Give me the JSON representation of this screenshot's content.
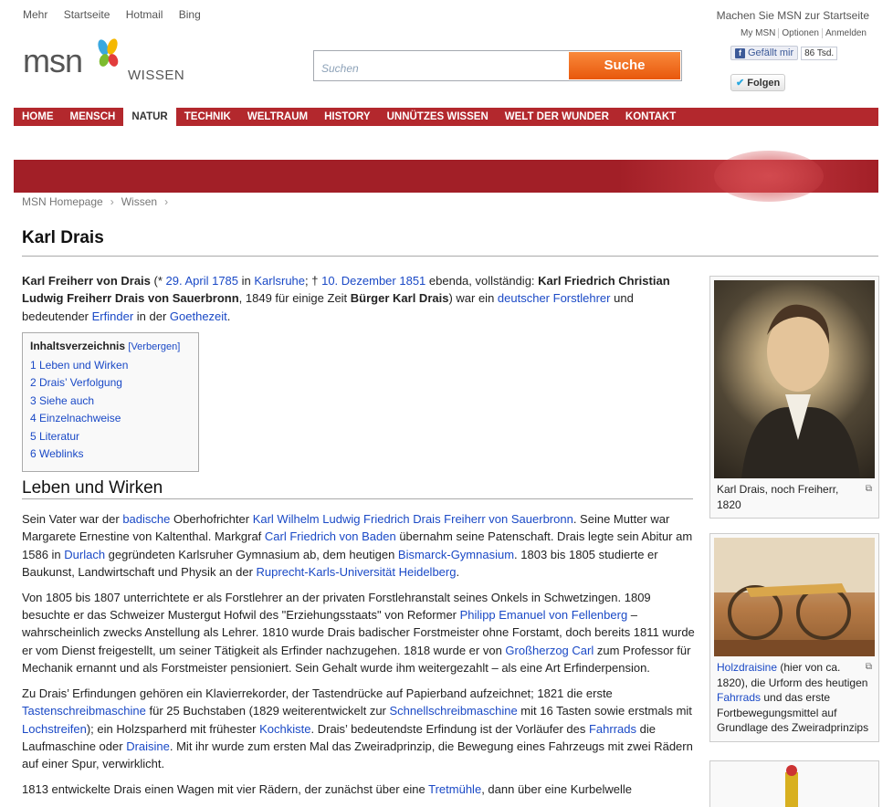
{
  "top_links": [
    "Mehr",
    "Startseite",
    "Hotmail",
    "Bing"
  ],
  "top_right": {
    "startpage": "Machen Sie MSN zur Startseite",
    "links": [
      "My MSN",
      "Optionen",
      "Anmelden"
    ],
    "fb_like": "Gefällt mir",
    "fb_count": "86 Tsd.",
    "twitter": "Folgen"
  },
  "logo": {
    "brand": "msn",
    "section": "WISSEN"
  },
  "search": {
    "placeholder": "Suchen",
    "button": "Suche"
  },
  "nav": [
    "HOME",
    "MENSCH",
    "NATUR",
    "TECHNIK",
    "WELTRAUM",
    "HISTORY",
    "UNNÜTZES WISSEN",
    "WELT DER WUNDER",
    "KONTAKT"
  ],
  "nav_active": "NATUR",
  "breadcrumb": [
    "MSN Homepage",
    "Wissen"
  ],
  "title": "Karl Drais",
  "toc": {
    "heading": "Inhaltsverzeichnis",
    "hide": "[Verbergen]",
    "items": [
      "1  Leben und Wirken",
      "2  Drais’ Verfolgung",
      "3  Siehe auch",
      "4  Einzelnachweise",
      "5  Literatur",
      "6  Weblinks"
    ]
  },
  "section1": "Leben und Wirken",
  "captions": {
    "c1": "Karl Drais, noch Freiherr, 1820",
    "c2_link1": "Holzdraisine",
    "c2_a": " (hier von ca. 1820), die Urform des heutigen ",
    "c2_link2": "Fahrrads",
    "c2_b": " und das erste Fortbewegungsmittel auf Grundlage des Zweiradprinzips"
  },
  "colors": {
    "nav_red": "#b3282d",
    "link": "#1a49c6",
    "search_orange": "#f07a2a"
  }
}
